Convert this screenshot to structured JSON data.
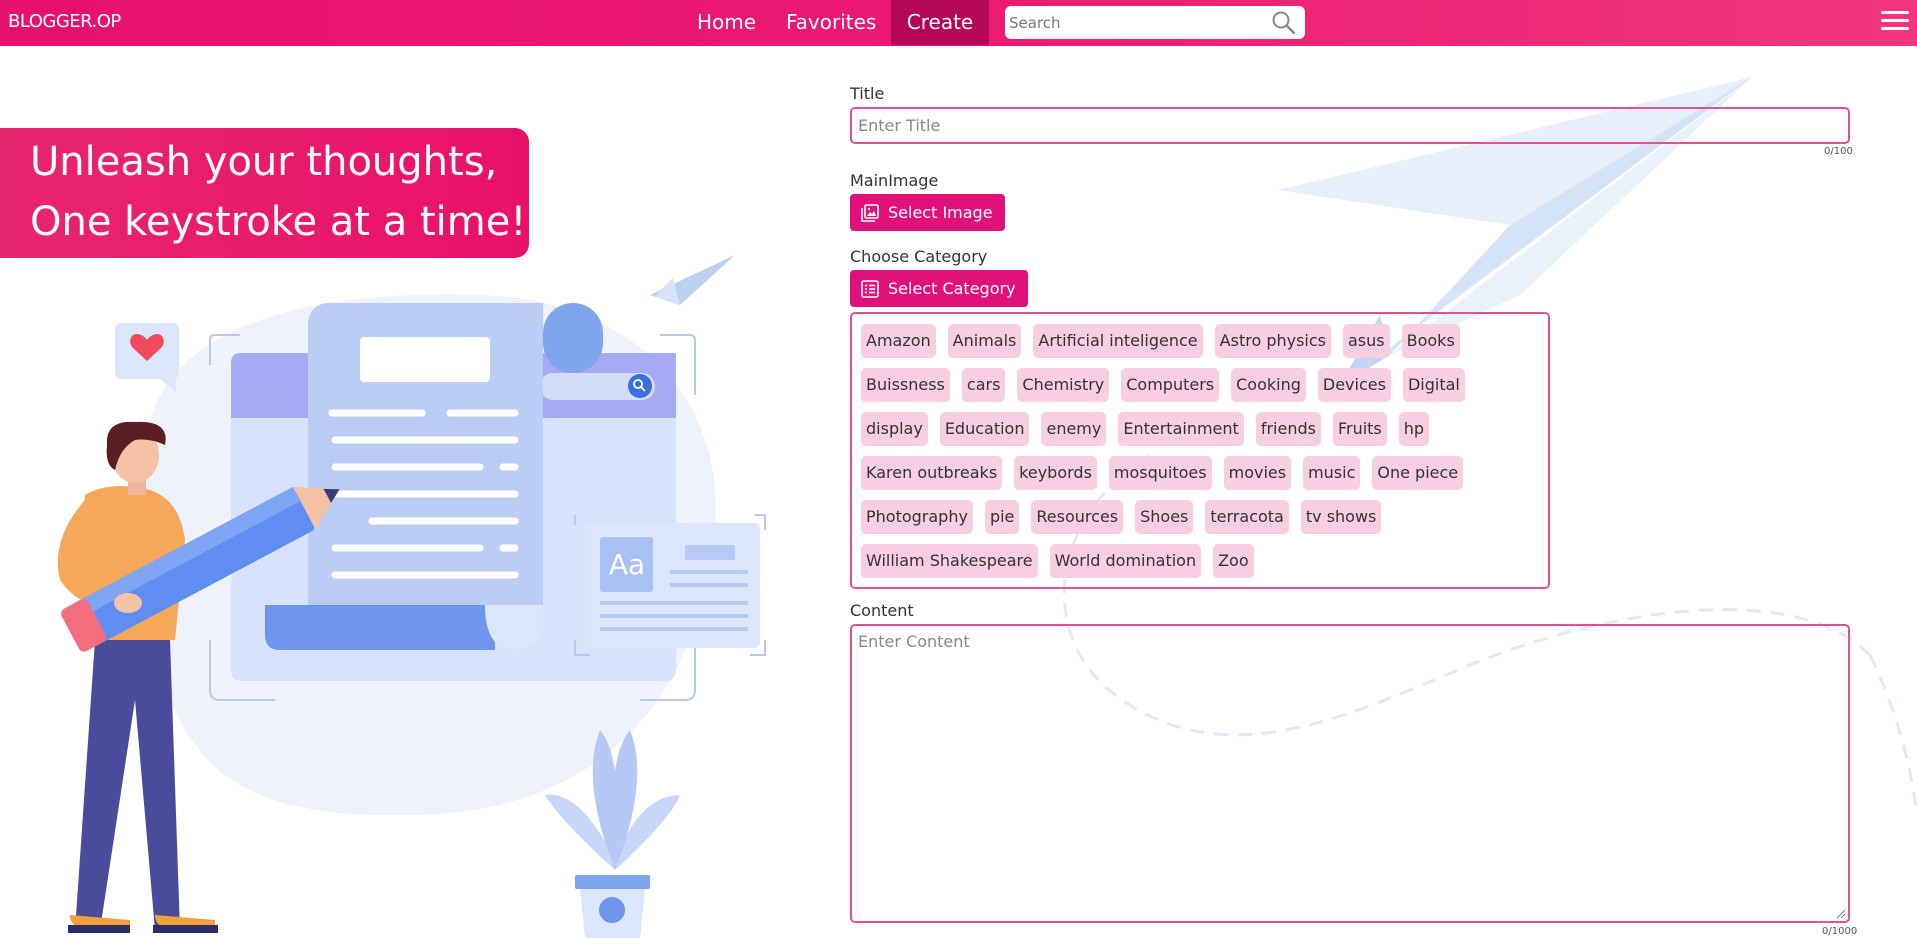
{
  "navbar": {
    "brand": "BLOGGER.OP",
    "links": [
      {
        "label": "Home"
      },
      {
        "label": "Favorites"
      },
      {
        "label": "Create",
        "active": true
      }
    ],
    "search": {
      "placeholder": "Search",
      "icon": "search-icon"
    },
    "menu_icon": "hamburger-icon"
  },
  "hero": {
    "line1": "Unleash your thoughts,",
    "line2": "One keystroke at a time!",
    "illustration_glyph": "Aa"
  },
  "form": {
    "title": {
      "label": "Title",
      "placeholder": "Enter Title",
      "counter": "0/100",
      "value": ""
    },
    "main_image": {
      "label": "MainImage",
      "button": "Select Image",
      "icon": "image-icon"
    },
    "category": {
      "label": "Choose Category",
      "button": "Select Category",
      "icon": "list-icon",
      "items": [
        "Amazon",
        "Animals",
        "Artificial inteligence",
        "Astro physics",
        "asus",
        "Books",
        "Buissness",
        "cars",
        "Chemistry",
        "Computers",
        "Cooking",
        "Devices",
        "Digital",
        "display",
        "Education",
        "enemy",
        "Entertainment",
        "friends",
        "Fruits",
        "hp",
        "Karen outbreaks",
        "keybords",
        "mosquitoes",
        "movies",
        "music",
        "One piece",
        "Photography",
        "pie",
        "Resources",
        "Shoes",
        "terracota",
        "tv shows",
        "William Shakespeare",
        "World domination",
        "Zoo"
      ]
    },
    "content": {
      "label": "Content",
      "placeholder": "Enter Content",
      "counter": "0/1000",
      "value": ""
    }
  },
  "colors": {
    "accent": "#e0117a",
    "nav_active": "#b50757",
    "chip_bg": "#f8cfe0",
    "border": "#e4508f"
  }
}
